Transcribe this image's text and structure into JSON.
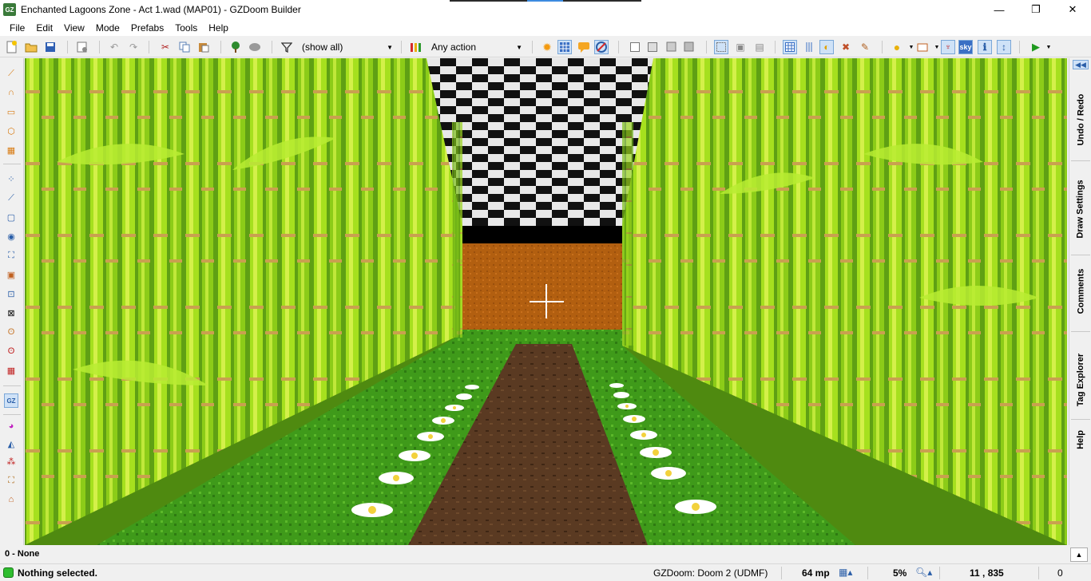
{
  "window": {
    "title": "Enchanted Lagoons Zone - Act 1.wad (MAP01) - GZDoom Builder",
    "icon_label": "GZ",
    "minimize": "—",
    "maximize": "❐",
    "close": "✕"
  },
  "menu": [
    "File",
    "Edit",
    "View",
    "Mode",
    "Prefabs",
    "Tools",
    "Help"
  ],
  "toolbar": {
    "filter_value": "(show all)",
    "action_value": "Any action"
  },
  "right_tabs": [
    "Undo / Redo",
    "Draw Settings",
    "Comments",
    "Tag Explorer",
    "Help"
  ],
  "right_top_glyph": "◀◀",
  "info": {
    "selection_label": "0 - None",
    "expand_glyph": "▲"
  },
  "status": {
    "message": "Nothing selected.",
    "engine": "GZDoom: Doom 2 (UDMF)",
    "grid": "64 mp",
    "zoom": "5%",
    "coords": "11 , 835",
    "last": "0"
  },
  "colors": {
    "bamboo_light": "#a6e01e",
    "bamboo_dark": "#4f8a10",
    "wall_orange": "#b25f10",
    "path_brown": "#5a3a22",
    "grass": "#3f9a1a",
    "status_led": "#2fbd2f"
  }
}
